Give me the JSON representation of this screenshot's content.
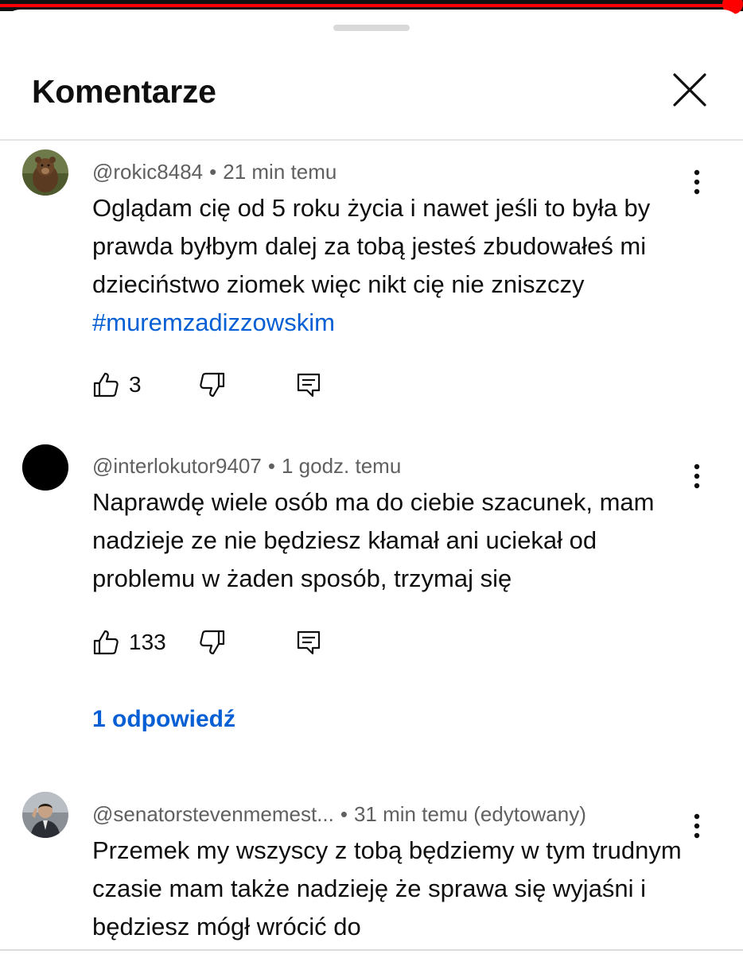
{
  "header": {
    "title": "Komentarze"
  },
  "colors": {
    "accent": "#ff0000",
    "link": "#065fd4",
    "meta": "#606060"
  },
  "icons": {
    "close": "close-icon",
    "more": "more-vertical-icon",
    "like": "thumb-up-icon",
    "dislike": "thumb-down-icon",
    "reply": "reply-icon"
  },
  "comments": [
    {
      "author": "@rokic8484",
      "time": "21 min temu",
      "text_before_hashtag": "Oglądam cię od 5 roku życia i nawet jeśli to była by prawda byłbym dalej za tobą jesteś zbudowałeś mi dzieciństwo ziomek więc nikt cię nie zniszczy ",
      "hashtag": "#muremzadizzowskim",
      "likes": "3"
    },
    {
      "author": "@interlokutor9407",
      "time": "1 godz. temu",
      "text": "Naprawdę wiele osób ma do ciebie szacunek, mam nadzieje ze nie będziesz kłamał ani uciekał od problemu w żaden sposób, trzymaj się",
      "likes": "133",
      "replies_label": "1 odpowiedź"
    },
    {
      "author": "@senatorstevenmemest...",
      "time": "31 min temu (edytowany)",
      "text": "Przemek my wszyscy z tobą będziemy  w tym trudnym czasie mam także nadzieję że sprawa się wyjaśni i będziesz mógł wrócić do"
    }
  ]
}
